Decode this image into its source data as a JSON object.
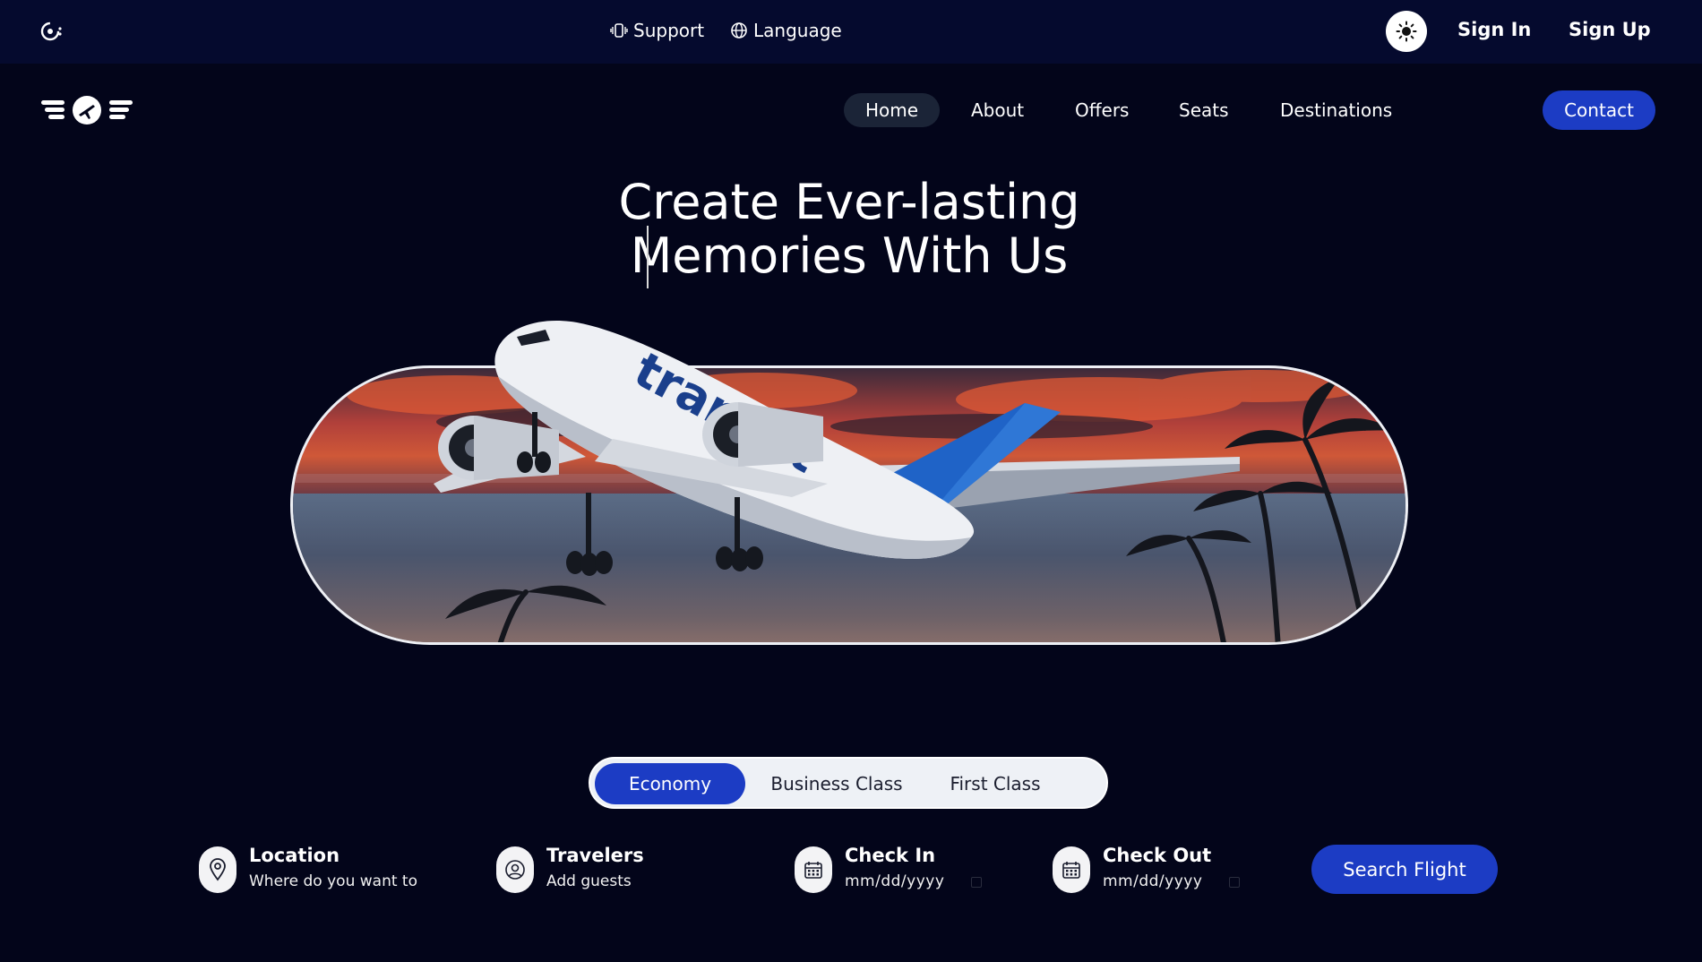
{
  "topbar": {
    "support_label": "Support",
    "language_label": "Language",
    "theme_icon": "sun-icon",
    "signin_label": "Sign In",
    "signup_label": "Sign Up"
  },
  "nav": {
    "items": [
      {
        "label": "Home",
        "active": true
      },
      {
        "label": "About"
      },
      {
        "label": "Offers"
      },
      {
        "label": "Seats"
      },
      {
        "label": "Destinations"
      }
    ],
    "contact_label": "Contact"
  },
  "hero": {
    "title_line1": "Create Ever-lasting",
    "title_line2": "Memories With Us",
    "airline_livery": "transat"
  },
  "class_tabs": {
    "items": [
      {
        "label": "Economy",
        "active": true
      },
      {
        "label": "Business Class"
      },
      {
        "label": "First Class"
      }
    ]
  },
  "search": {
    "location": {
      "label": "Location",
      "value": "Where do you want to"
    },
    "travelers": {
      "label": "Travelers",
      "value": "Add guests"
    },
    "check_in": {
      "label": "Check In",
      "value": "mm/dd/yyyy"
    },
    "check_out": {
      "label": "Check Out",
      "value": "mm/dd/yyyy"
    },
    "button_label": "Search Flight"
  },
  "colors": {
    "background": "#03051a",
    "topbar": "#050a2e",
    "accent": "#1c3cc4",
    "nav_active": "#1b2437"
  }
}
